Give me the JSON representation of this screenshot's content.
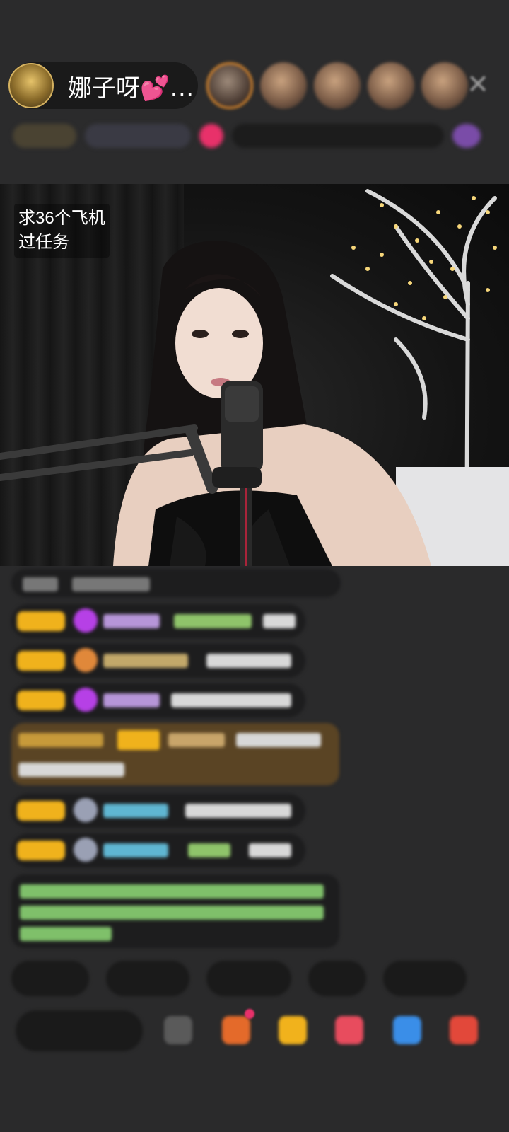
{
  "header": {
    "host_name": "娜子呀💕…",
    "close_label": "✕"
  },
  "video": {
    "overlay_line1": "求36个飞机",
    "overlay_line2": "过任务"
  },
  "colors": {
    "badge_gold": "#f0b21c",
    "chat_bg": "#1d1d1e",
    "accent_pink": "#e8316a"
  },
  "icons": {
    "close": "close-icon",
    "gift": "gift-icon",
    "share": "share-icon"
  }
}
